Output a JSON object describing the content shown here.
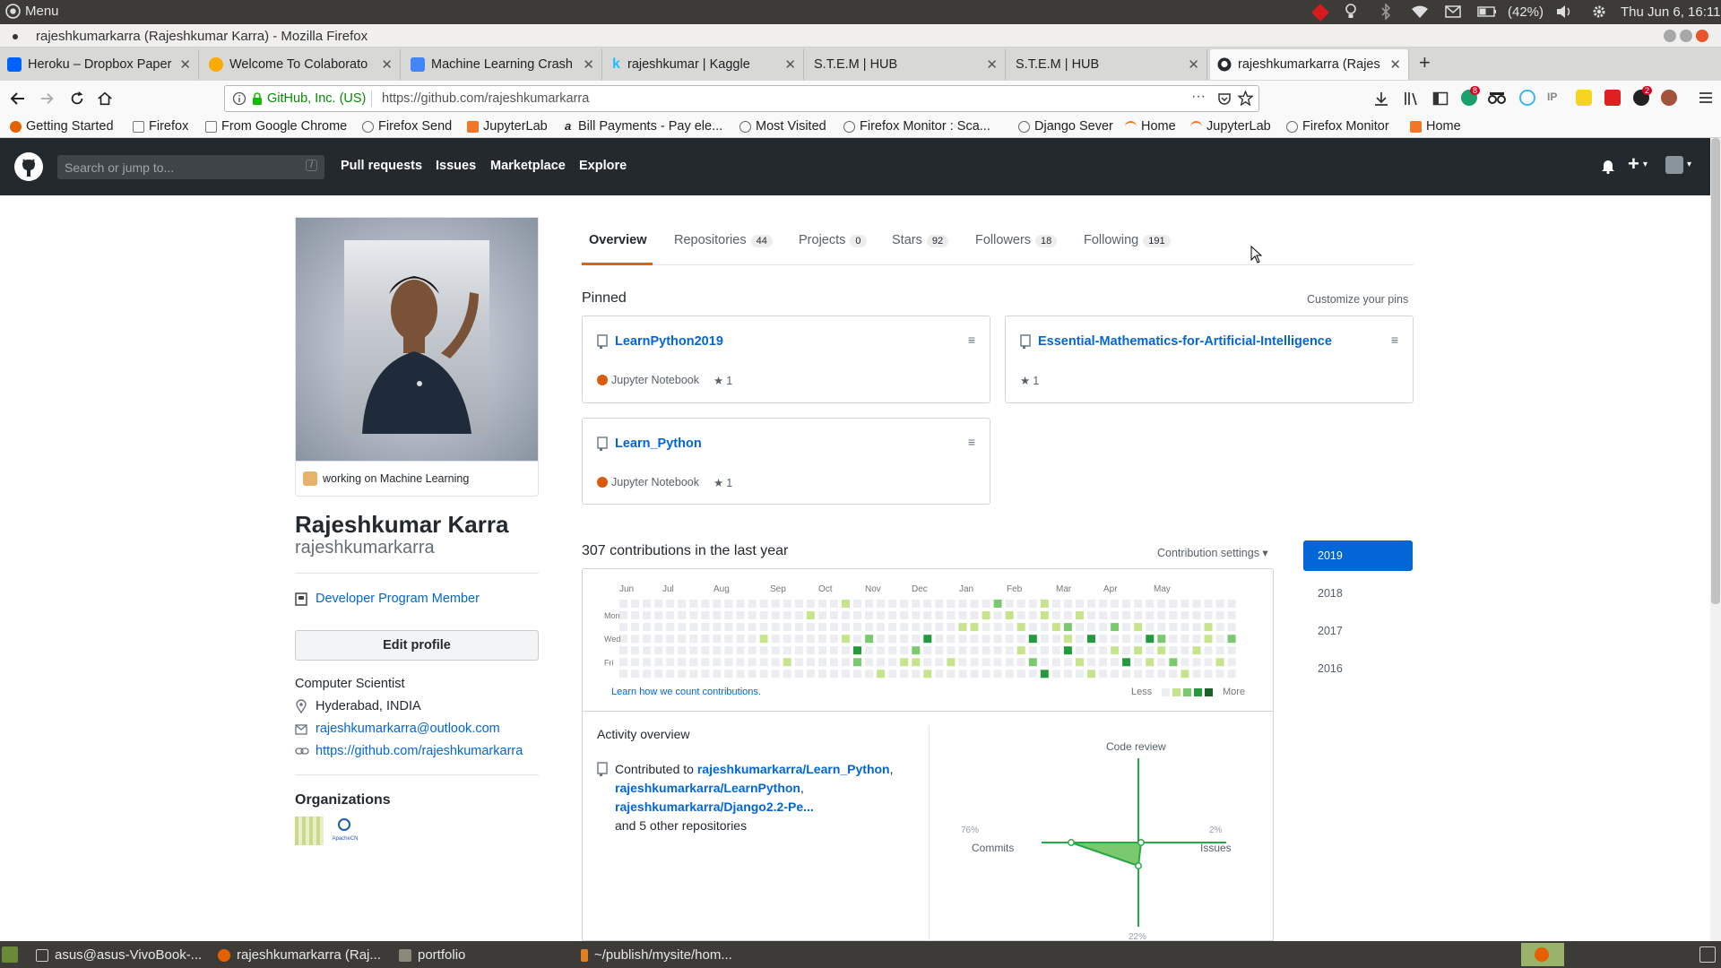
{
  "system_panel": {
    "menu": "Menu",
    "battery": "(42%)",
    "datetime": "Thu Jun 6, 16:11"
  },
  "window": {
    "title": "rajeshkumarkarra (Rajeshkumar Karra) - Mozilla Firefox"
  },
  "tabs": [
    {
      "label": "Heroku – Dropbox Paper",
      "color": "#0061ff"
    },
    {
      "label": "Welcome To Colaborato",
      "color": "#f9ab00"
    },
    {
      "label": "Machine Learning Crash",
      "color": "#4285f4"
    },
    {
      "label": "rajeshkumar | Kaggle",
      "color": "#20beff"
    },
    {
      "label": "S.T.E.M | HUB",
      "color": ""
    },
    {
      "label": "S.T.E.M | HUB",
      "color": ""
    },
    {
      "label": "rajeshkumarkarra (Rajes",
      "color": "#24292e",
      "active": true
    }
  ],
  "nav": {
    "identity": "GitHub, Inc. (US)",
    "url": "https://github.com/rajeshkumarkarra",
    "more": "···",
    "overflow_icon": "menu-icon",
    "badge_addon_1": "8",
    "badge_addon_2": "2"
  },
  "bookmarks": [
    {
      "label": "Getting Started",
      "color": "#e66000"
    },
    {
      "label": "Firefox",
      "color": "#8a8a8a"
    },
    {
      "label": "From Google Chrome",
      "color": "#8a8a8a"
    },
    {
      "label": "Firefox Send",
      "color": "#6a6a6a"
    },
    {
      "label": "JupyterLab",
      "color": "#f37626"
    },
    {
      "label": "Bill Payments - Pay ele...",
      "color": "#ff9900"
    },
    {
      "label": "Most Visited",
      "color": "#6a6a6a"
    },
    {
      "label": "Firefox Monitor : Sca...",
      "color": "#6a6a6a"
    },
    {
      "label": "Django Sever",
      "color": "#6a6a6a"
    },
    {
      "label": "Home",
      "color": "#f37626"
    },
    {
      "label": "JupyterLab",
      "color": "#f37626"
    },
    {
      "label": "Firefox Monitor",
      "color": "#6a6a6a"
    },
    {
      "label": "Home",
      "color": "#f37626"
    }
  ],
  "github": {
    "search_placeholder": "Search or jump to...",
    "search_key": "/",
    "nav": [
      "Pull requests",
      "Issues",
      "Marketplace",
      "Explore"
    ],
    "plus": "+",
    "caret": "▾"
  },
  "profile": {
    "status": "working on Machine Learning",
    "name": "Rajeshkumar Karra",
    "username": "rajeshkumarkarra",
    "badge": "Developer Program Member",
    "edit": "Edit profile",
    "bio": "Computer Scientist",
    "location": "Hyderabad, INDIA",
    "email": "rajeshkumarkarra@outlook.com",
    "website": "https://github.com/rajeshkumarkarra",
    "orgs_title": "Organizations",
    "org2_label": "ApacheCN"
  },
  "tabnav": [
    {
      "label": "Overview",
      "count": ""
    },
    {
      "label": "Repositories",
      "count": "44"
    },
    {
      "label": "Projects",
      "count": "0"
    },
    {
      "label": "Stars",
      "count": "92"
    },
    {
      "label": "Followers",
      "count": "18"
    },
    {
      "label": "Following",
      "count": "191"
    }
  ],
  "pinned": {
    "title": "Pinned",
    "customize": "Customize your pins",
    "repos": [
      {
        "name": "LearnPython2019",
        "lang": "Jupyter Notebook",
        "stars": "1"
      },
      {
        "name": "Essential-Mathematics-for-Artificial-Intelligence",
        "lang": "",
        "stars": "1"
      },
      {
        "name": "Learn_Python",
        "lang": "Jupyter Notebook",
        "stars": "1"
      }
    ]
  },
  "contrib": {
    "title": "307 contributions in the last year",
    "settings": "Contribution settings ▾",
    "months": [
      "Jun",
      "Jul",
      "Aug",
      "Sep",
      "Oct",
      "Nov",
      "Dec",
      "Jan",
      "Feb",
      "Mar",
      "Apr",
      "May"
    ],
    "days": [
      "Mon",
      "Wed",
      "Fri"
    ],
    "learn": "Learn how we count contributions.",
    "less": "Less",
    "more": "More",
    "level_colors": [
      "#ebedf0",
      "#c6e48b",
      "#7bc96f",
      "#239a3b",
      "#196127"
    ],
    "cells": [
      [
        8,
        7,
        2
      ],
      [
        12,
        3,
        1
      ],
      [
        14,
        5,
        1
      ],
      [
        16,
        1,
        1
      ],
      [
        19,
        0,
        1
      ],
      [
        19,
        3,
        1
      ],
      [
        20,
        4,
        3
      ],
      [
        20,
        5,
        2
      ],
      [
        21,
        3,
        2
      ],
      [
        22,
        6,
        1
      ],
      [
        24,
        5,
        1
      ],
      [
        25,
        4,
        2
      ],
      [
        25,
        5,
        1
      ],
      [
        26,
        3,
        3
      ],
      [
        26,
        6,
        1
      ],
      [
        28,
        5,
        1
      ],
      [
        29,
        2,
        1
      ],
      [
        30,
        2,
        1
      ],
      [
        31,
        1,
        1
      ],
      [
        32,
        0,
        2
      ],
      [
        33,
        1,
        1
      ],
      [
        34,
        2,
        1
      ],
      [
        34,
        4,
        1
      ],
      [
        35,
        3,
        3
      ],
      [
        35,
        5,
        2
      ],
      [
        36,
        0,
        1
      ],
      [
        36,
        1,
        1
      ],
      [
        36,
        6,
        3
      ],
      [
        37,
        2,
        1
      ],
      [
        38,
        2,
        2
      ],
      [
        38,
        3,
        1
      ],
      [
        38,
        4,
        3
      ],
      [
        39,
        1,
        1
      ],
      [
        39,
        5,
        1
      ],
      [
        40,
        3,
        3
      ],
      [
        40,
        6,
        1
      ],
      [
        42,
        2,
        2
      ],
      [
        42,
        4,
        1
      ],
      [
        43,
        5,
        3
      ],
      [
        44,
        2,
        1
      ],
      [
        44,
        4,
        1
      ],
      [
        45,
        3,
        3
      ],
      [
        45,
        5,
        1
      ],
      [
        46,
        3,
        2
      ],
      [
        46,
        4,
        1
      ],
      [
        47,
        5,
        2
      ],
      [
        48,
        6,
        1
      ],
      [
        49,
        4,
        1
      ],
      [
        50,
        2,
        1
      ],
      [
        50,
        3,
        1
      ],
      [
        51,
        5,
        1
      ],
      [
        52,
        3,
        2
      ],
      [
        53,
        4,
        1
      ],
      [
        54,
        1,
        3
      ],
      [
        54,
        2,
        2
      ],
      [
        55,
        3,
        1
      ],
      [
        56,
        3,
        1
      ],
      [
        57,
        4,
        1
      ]
    ]
  },
  "years": [
    {
      "label": "2019",
      "selected": true
    },
    {
      "label": "2018"
    },
    {
      "label": "2017"
    },
    {
      "label": "2016"
    }
  ],
  "activity": {
    "title": "Activity overview",
    "prefix": "Contributed to ",
    "repo1": "rajeshkumarkarra/Learn_Python",
    "repo2": "rajeshkumarkarra/LearnPython",
    "repo3": "rajeshkumarkarra/Django2.2-Pe...",
    "others": "and 5 other repositories",
    "chart": {
      "code_review_label": "Code review",
      "commits_label": "Commits",
      "commits_pct": "76%",
      "issues_label": "Issues",
      "issues_pct": "2%",
      "prs_pct": "22%"
    }
  },
  "taskbar": [
    {
      "label": "asus@asus-VivoBook-...",
      "color": "#555"
    },
    {
      "label": "rajeshkumarkarra (Raj...",
      "color": "#e66000"
    },
    {
      "label": "portfolio",
      "color": "#7a7a7a"
    },
    {
      "label": "~/publish/mysite/hom...",
      "color": "#e08020"
    }
  ]
}
